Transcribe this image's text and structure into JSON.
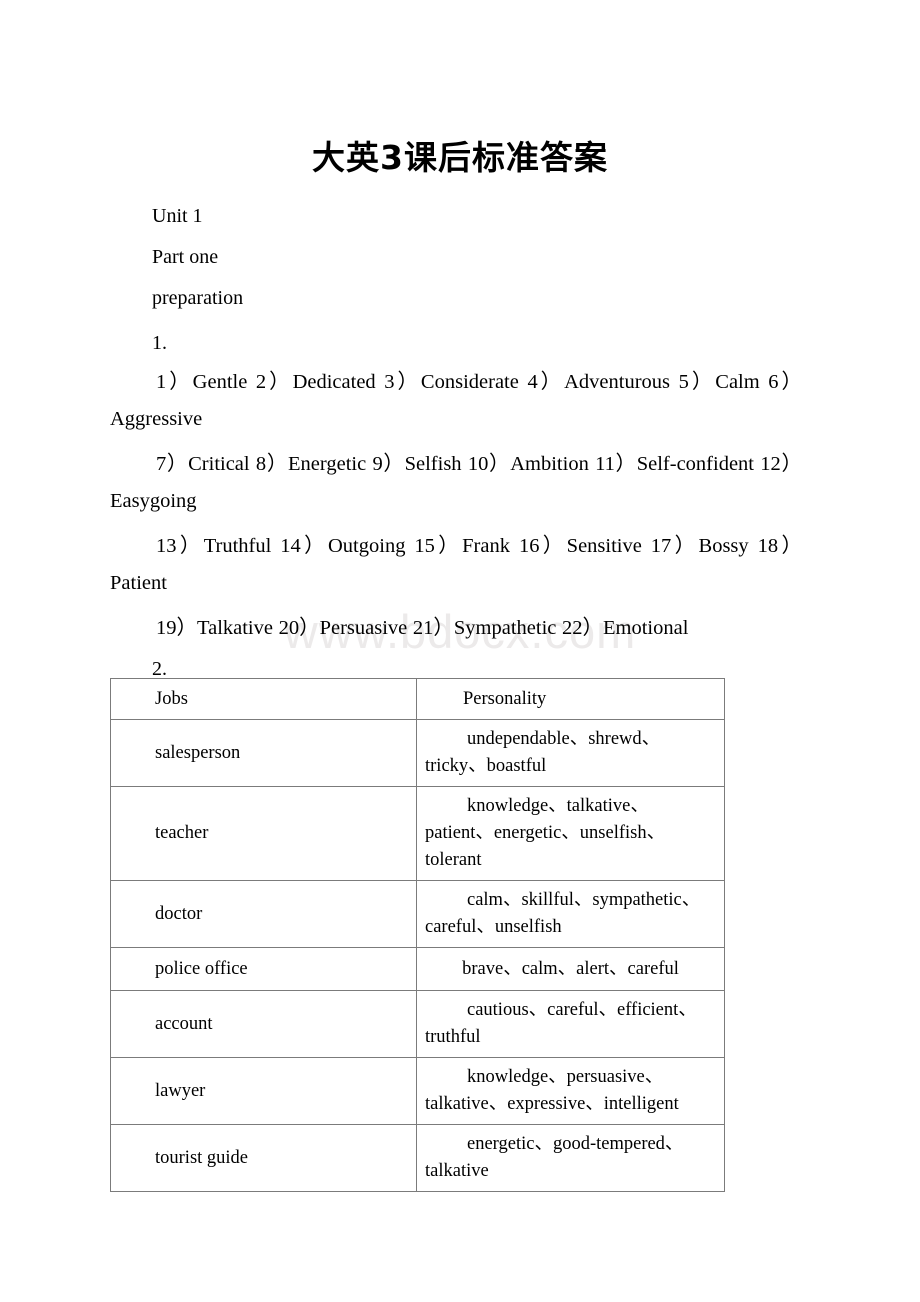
{
  "document": {
    "title": "大英3课后标准答案",
    "watermark": "www.bdocx.com",
    "heading_lines": [
      "Unit 1",
      "Part one",
      "preparation"
    ],
    "section_1_label": "1.",
    "section_2_label": "2.",
    "answers": [
      "1）Gentle 2）Dedicated 3）Considerate 4）Adventurous 5）Calm 6）Aggressive",
      "7）Critical 8）Energetic 9）Selfish 10）Ambition 11）Self-confident 12）Easygoing",
      "13）Truthful 14）Outgoing 15）Frank 16）Sensitive 17）Bossy 18）Patient",
      "19）Talkative 20）Persuasive 21）Sympathetic 22）Emotional"
    ]
  },
  "table": {
    "headers": [
      "Jobs",
      "Personality"
    ],
    "rows": [
      {
        "job": "salesperson",
        "personality": "undependable、shrewd、tricky、boastful",
        "lines": 2
      },
      {
        "job": "teacher",
        "personality": "knowledge、talkative、patient、energetic、unselfish、tolerant",
        "lines": 2
      },
      {
        "job": "doctor",
        "personality": "calm、skillful、sympathetic、careful、unselfish",
        "lines": 2
      },
      {
        "job": "police office",
        "personality": "brave、calm、alert、careful",
        "lines": 1
      },
      {
        "job": "account",
        "personality": "cautious、careful、efficient、truthful",
        "lines": 2
      },
      {
        "job": "lawyer",
        "personality": "knowledge、persuasive、talkative、expressive、intelligent",
        "lines": 2
      },
      {
        "job": "tourist guide",
        "personality": "energetic、good-tempered、talkative",
        "lines": 2
      }
    ]
  },
  "colors": {
    "text": "#000000",
    "page_background": "#ffffff",
    "table_border": "#7b7b7b",
    "watermark": "#eceaea"
  }
}
